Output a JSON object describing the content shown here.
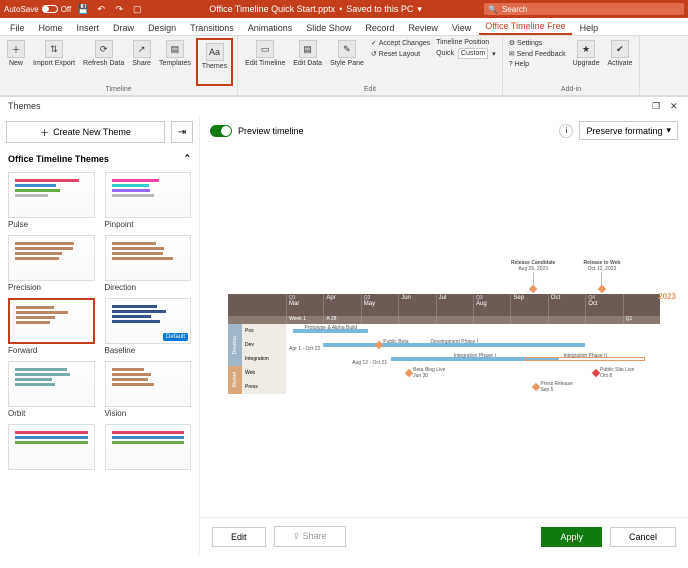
{
  "titlebar": {
    "autosave_label": "AutoSave",
    "autosave_state": "Off",
    "doc_title": "Office Timeline Quick Start.pptx",
    "saved_status": "Saved to this PC",
    "search_placeholder": "Search"
  },
  "menutabs": [
    "File",
    "Home",
    "Insert",
    "Draw",
    "Design",
    "Transitions",
    "Animations",
    "Slide Show",
    "Record",
    "Review",
    "View",
    "Office Timeline Free",
    "Help"
  ],
  "menutabs_active": 11,
  "ribbon": {
    "groups": [
      {
        "label": "Timeline",
        "buttons": [
          "New",
          "Import Export",
          "Refresh Data",
          "Share",
          "Templates",
          "Themes"
        ]
      },
      {
        "label": "Edit",
        "buttons": [
          "Edit Timeline",
          "Edit Data",
          "Style Pane"
        ],
        "checks": [
          "Accept Changes",
          "Reset Layout"
        ],
        "tp_label": "Timeline Position",
        "quick": "Quick",
        "custom": "Custom"
      },
      {
        "label": "Add-in",
        "items": [
          "Settings",
          "Send Feedback",
          "Help"
        ],
        "upgrade": "Upgrade",
        "activate": "Activate"
      }
    ]
  },
  "pane": {
    "title": "Themes",
    "create_label": "Create New Theme",
    "section_label": "Office Timeline Themes",
    "themes": [
      {
        "name": "Pulse",
        "cls": "c1"
      },
      {
        "name": "Pinpoint",
        "cls": "c2"
      },
      {
        "name": "Precision",
        "cls": "c3"
      },
      {
        "name": "Direction",
        "cls": "c3"
      },
      {
        "name": "Forward",
        "cls": "c3",
        "selected": true
      },
      {
        "name": "Baseline",
        "cls": "c5",
        "default": true
      },
      {
        "name": "Orbit",
        "cls": "c4"
      },
      {
        "name": "Vision",
        "cls": "c3"
      }
    ],
    "preview_label": "Preview timeline",
    "preserve_label": "Preserve formating",
    "default_badge": "Default"
  },
  "chart_data": {
    "type": "gantt",
    "year": "2023",
    "columns": [
      {
        "q": "Q1",
        "m": "Mar"
      },
      {
        "q": "",
        "m": "Apr"
      },
      {
        "q": "Q2",
        "m": "May"
      },
      {
        "q": "",
        "m": "Jun"
      },
      {
        "q": "",
        "m": "Jul"
      },
      {
        "q": "Q3",
        "m": "Aug"
      },
      {
        "q": "",
        "m": "Sep"
      },
      {
        "q": "",
        "m": "Oct"
      },
      {
        "q": "Q4",
        "m": "Oct"
      },
      {
        "q": "",
        "m": ""
      }
    ],
    "subhead": [
      "Week 1",
      "A 28",
      "",
      "",
      "",
      "",
      "",
      "",
      "",
      "Q1"
    ],
    "callouts": [
      {
        "label": "Release Candidate",
        "date": "Aug 25, 2023",
        "x": 0.62
      },
      {
        "label": "Release to Web",
        "date": "Oct 12, 2023",
        "x": 0.82
      }
    ],
    "sections": [
      {
        "name": "Develop",
        "color": "#9fb7c9",
        "rows": [
          {
            "name": "Pos",
            "tasks": [
              {
                "label": "Prototype & Alpha Build",
                "x": 0.02,
                "w": 0.2,
                "color": "#7bb8d9"
              }
            ]
          },
          {
            "name": "Dev",
            "tasks": [
              {
                "label": "Development Phase I",
                "sub": "Apr 1 - Oct 22",
                "x": 0.1,
                "w": 0.7,
                "color": "#7bb8d9"
              }
            ],
            "milestones": [
              {
                "label": "Public Beta",
                "x": 0.24
              }
            ]
          },
          {
            "name": "Integration",
            "tasks": [
              {
                "label": "Integration Phase I",
                "sub": "Aug 12 - Oct 21",
                "x": 0.28,
                "w": 0.45,
                "color": "#7bb8d9"
              },
              {
                "label": "Integration Phase II",
                "x": 0.64,
                "w": 0.32,
                "color": "#e89860",
                "outline": true
              }
            ]
          }
        ]
      },
      {
        "name": "Market",
        "color": "#d9a77a",
        "rows": [
          {
            "name": "Web",
            "tasks": [],
            "milestones": [
              {
                "label": "Beta Blog Live",
                "sub": "Jun 30",
                "x": 0.32
              },
              {
                "label": "Public Site Live",
                "sub": "Oct 8",
                "x": 0.82,
                "color": "#d44"
              }
            ]
          },
          {
            "name": "Press",
            "tasks": [],
            "milestones": [
              {
                "label": "Press Release",
                "sub": "Sep 5",
                "x": 0.66
              }
            ]
          }
        ]
      }
    ]
  },
  "footer": {
    "edit": "Edit",
    "share": "Share",
    "apply": "Apply",
    "cancel": "Cancel"
  }
}
